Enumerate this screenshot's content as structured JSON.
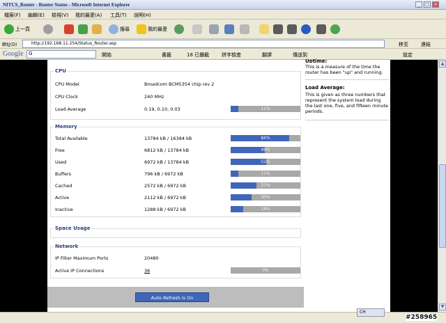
{
  "window": {
    "title": "NITCS_Router - Router Status - Microsoft Internet Explorer"
  },
  "menu": [
    "檔案(F)",
    "編輯(E)",
    "檢視(V)",
    "我的最愛(A)",
    "工具(T)",
    "說明(H)"
  ],
  "toolbar": {
    "back_label": "上一頁",
    "search_label": "搜尋",
    "favorites_label": "我的最愛"
  },
  "address": {
    "label": "網址(D)",
    "url": "http://192.168.11.254/Status_Router.asp",
    "go_label": "移至",
    "links_label": "連結"
  },
  "googlebar": {
    "brand": "Google",
    "search_placeholder": "G",
    "start_label": "開始",
    "bookmarks_label": "書籤",
    "blocked_label": "18 已攔截",
    "spell_label": "拼字檢查",
    "translate_label": "翻譯",
    "sendto_label": "傳送到",
    "settings_label": "設定"
  },
  "sidebar": {
    "top_line": "Uptime:",
    "top_text": "This is a measure of the time the router has been \"up\" and running.",
    "load_title": "Load Average:",
    "load_text": "This is given as three numbers that represent the system load during the last one, five, and fifteen minute periods."
  },
  "cpu": {
    "title": "CPU",
    "rows": [
      {
        "label": "CPU Model",
        "value": "Broadcom BCM5354 chip rev 2"
      },
      {
        "label": "CPU Clock",
        "value": "240 MHz"
      },
      {
        "label": "Load Average",
        "value": "0.19, 0.10, 0.03",
        "pct": 11,
        "pct_label": "11%"
      }
    ]
  },
  "memory": {
    "title": "Memory",
    "rows": [
      {
        "label": "Total Available",
        "value": "13784 kB / 16384 kB",
        "pct": 84,
        "pct_label": "84%"
      },
      {
        "label": "Free",
        "value": "6812 kB / 13784 kB",
        "pct": 49,
        "pct_label": "49%"
      },
      {
        "label": "Used",
        "value": "6972 kB / 13784 kB",
        "pct": 51,
        "pct_label": "51%"
      },
      {
        "label": "Buffers",
        "value": "796 kB / 6972 kB",
        "pct": 11,
        "pct_label": "11%"
      },
      {
        "label": "Cached",
        "value": "2572 kB / 6972 kB",
        "pct": 37,
        "pct_label": "37%"
      },
      {
        "label": "Active",
        "value": "2112 kB / 6972 kB",
        "pct": 30,
        "pct_label": "30%"
      },
      {
        "label": "Inactive",
        "value": "1288 kB / 6972 kB",
        "pct": 18,
        "pct_label": "18%"
      }
    ]
  },
  "space": {
    "title": "Space Usage"
  },
  "network": {
    "title": "Network",
    "rows": [
      {
        "label": "IP Filter Maximum Ports",
        "value": "20480"
      },
      {
        "label": "Active IP Connections",
        "value": "36",
        "pct": 0,
        "pct_label": "0%"
      }
    ]
  },
  "footer": {
    "autorefresh_label": "Auto-Refresh is On"
  },
  "statusbar": {
    "ime": "CH",
    "watermark": "#258965"
  },
  "colors": {
    "bar_fill": "#3f66b8",
    "bar_bg": "#a8a8a8",
    "section_title": "#2a3f7a"
  }
}
